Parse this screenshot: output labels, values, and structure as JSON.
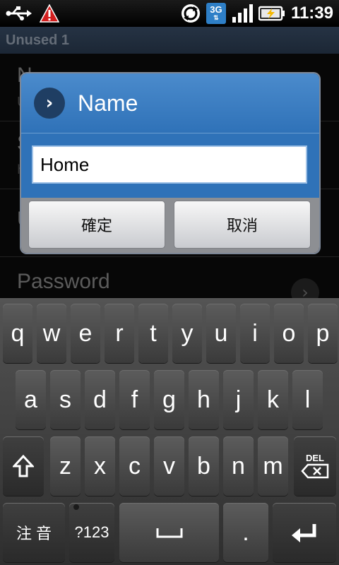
{
  "status_bar": {
    "icons": [
      "usb-icon",
      "warning-icon",
      "sync-icon",
      "network-3g-icon",
      "signal-icon",
      "battery-charging-icon"
    ],
    "network_label": "3G",
    "time": "11:39"
  },
  "app": {
    "title": "Unused 1"
  },
  "list": {
    "rows": [
      {
        "title": "N",
        "sub": "U"
      },
      {
        "title": "S",
        "sub": "h"
      },
      {
        "title": "U",
        "sub": ""
      },
      {
        "title": "Password",
        "sub": ""
      }
    ]
  },
  "dialog": {
    "title": "Name",
    "input_value": "Home",
    "ok_label": "確定",
    "cancel_label": "取消"
  },
  "keyboard": {
    "row1": [
      "q",
      "w",
      "e",
      "r",
      "t",
      "y",
      "u",
      "i",
      "o",
      "p"
    ],
    "row2": [
      "a",
      "s",
      "d",
      "f",
      "g",
      "h",
      "j",
      "k",
      "l"
    ],
    "row3": [
      "z",
      "x",
      "c",
      "v",
      "b",
      "n",
      "m"
    ],
    "del_label": "DEL",
    "lang_label": "注 音",
    "symbols_label": "?123",
    "period_label": "."
  }
}
